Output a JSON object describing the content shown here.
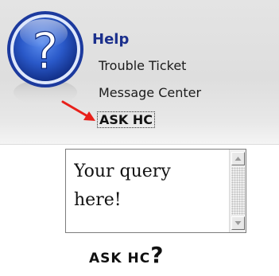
{
  "help_panel": {
    "icon": "help-question-icon",
    "title": "Help",
    "links": [
      "Trouble Ticket",
      "Message Center"
    ],
    "ask_link": "ASK HC"
  },
  "query": {
    "value": "Your query here!"
  },
  "ask_button": {
    "label": "ASK HC",
    "question_mark": "?"
  },
  "colors": {
    "title": "#1b2f8c",
    "arrow": "#e8201a",
    "icon_ring": "#1c3a9e",
    "panel_bg": "#e0e0e0"
  }
}
